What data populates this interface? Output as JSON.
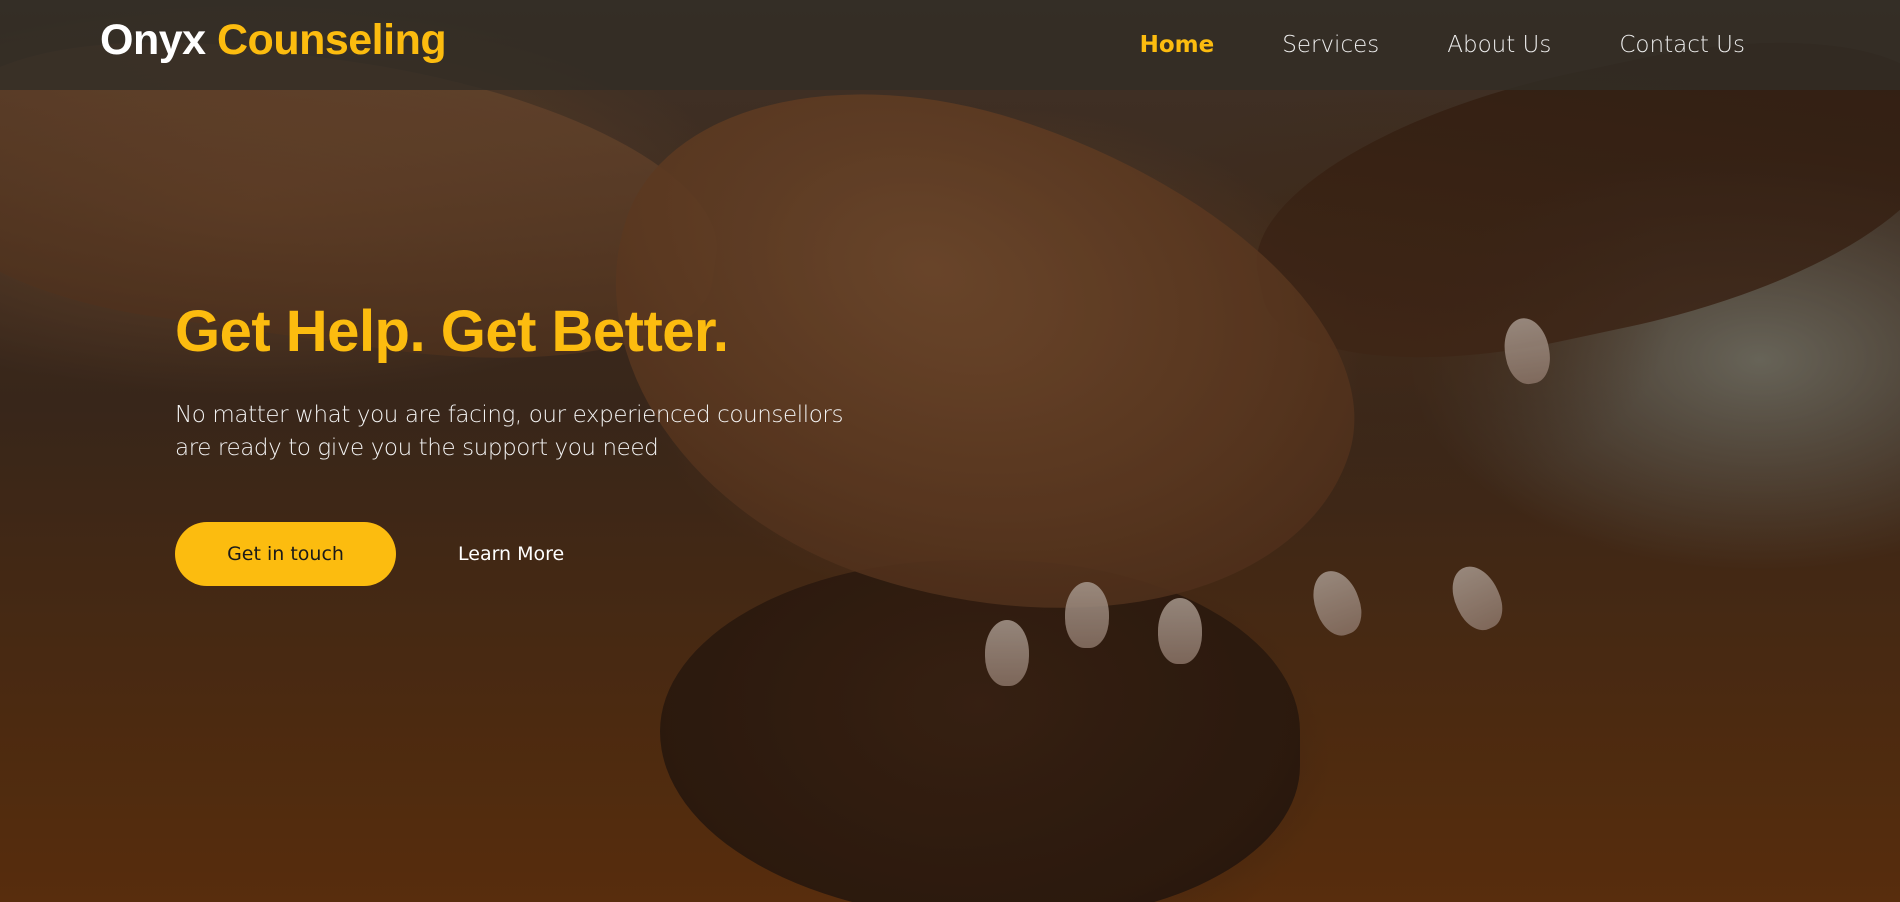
{
  "brand": {
    "name_part1": "Onyx",
    "name_part2": "Counseling"
  },
  "nav": {
    "items": [
      {
        "label": "Home",
        "active": true
      },
      {
        "label": "Services",
        "active": false
      },
      {
        "label": "About Us",
        "active": false
      },
      {
        "label": "Contact Us",
        "active": false
      }
    ]
  },
  "hero": {
    "title": "Get Help. Get Better.",
    "subtitle": "No matter what you are facing, our experienced counsellors are ready to give you the support you need",
    "primary_cta": "Get in touch",
    "secondary_cta": "Learn More",
    "background_image": "hands-holding-photo"
  },
  "colors": {
    "accent": "#fcbc0f",
    "navbar_bg": "#322d26",
    "text_light": "#ffffff"
  }
}
